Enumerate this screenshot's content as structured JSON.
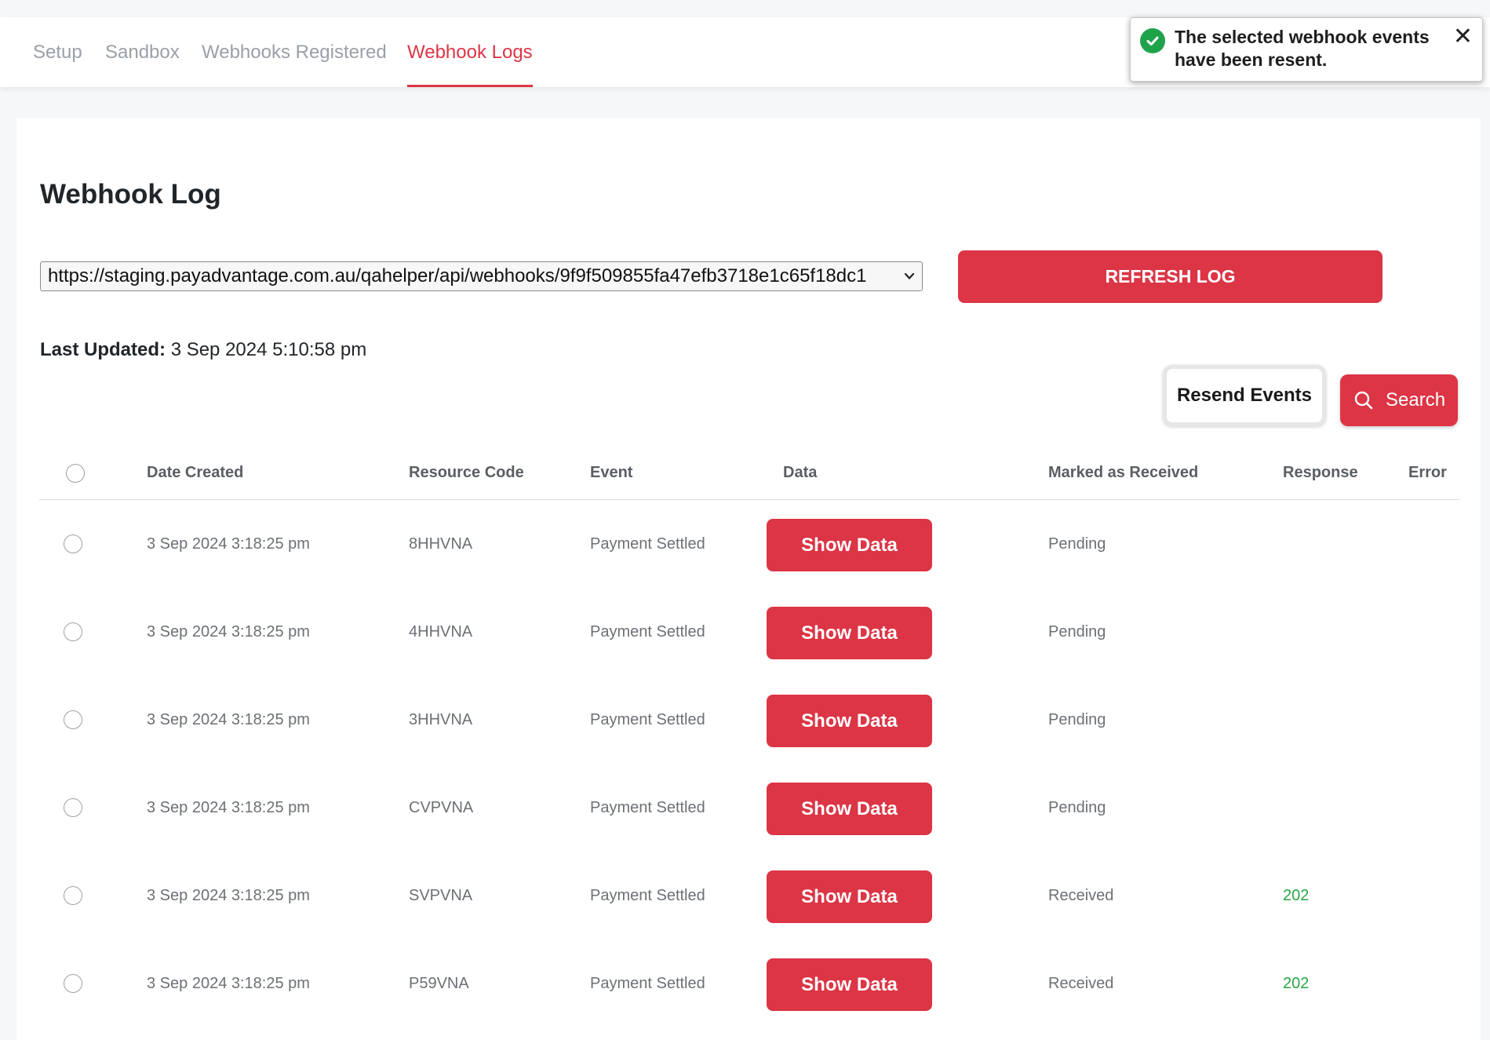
{
  "nav": {
    "tabs": [
      {
        "label": "Setup",
        "active": false
      },
      {
        "label": "Sandbox",
        "active": false
      },
      {
        "label": "Webhooks Registered",
        "active": false
      },
      {
        "label": "Webhook Logs",
        "active": true
      }
    ]
  },
  "toast": {
    "message": "The selected webhook events have been resent.",
    "icon": "check-circle-icon",
    "close_icon": "close-icon"
  },
  "main": {
    "title": "Webhook Log",
    "url_select_value": "https://staging.payadvantage.com.au/qahelper/api/webhooks/9f9f509855fa47efb3718e1c65f18dc1",
    "refresh_button": "REFRESH LOG",
    "last_updated_label": "Last Updated:",
    "last_updated_value": "3 Sep 2024 5:10:58 pm",
    "resend_button": "Resend Events",
    "search_button": "Search",
    "search_icon": "search-icon"
  },
  "table": {
    "headers": {
      "date_created": "Date Created",
      "resource_code": "Resource Code",
      "event": "Event",
      "data": "Data",
      "marked_as_received": "Marked as Received",
      "response": "Response",
      "error": "Error"
    },
    "show_data_label": "Show Data",
    "rows": [
      {
        "date": "3 Sep 2024 3:18:25 pm",
        "code": "8HHVNA",
        "event": "Payment Settled",
        "marked": "Pending",
        "response": "",
        "error": ""
      },
      {
        "date": "3 Sep 2024 3:18:25 pm",
        "code": "4HHVNA",
        "event": "Payment Settled",
        "marked": "Pending",
        "response": "",
        "error": ""
      },
      {
        "date": "3 Sep 2024 3:18:25 pm",
        "code": "3HHVNA",
        "event": "Payment Settled",
        "marked": "Pending",
        "response": "",
        "error": ""
      },
      {
        "date": "3 Sep 2024 3:18:25 pm",
        "code": "CVPVNA",
        "event": "Payment Settled",
        "marked": "Pending",
        "response": "",
        "error": ""
      },
      {
        "date": "3 Sep 2024 3:18:25 pm",
        "code": "SVPVNA",
        "event": "Payment Settled",
        "marked": "Received",
        "response": "202",
        "error": ""
      },
      {
        "date": "3 Sep 2024 3:18:25 pm",
        "code": "P59VNA",
        "event": "Payment Settled",
        "marked": "Received",
        "response": "202",
        "error": ""
      }
    ]
  },
  "colors": {
    "accent": "#dc3545",
    "success": "#28a745",
    "toast_icon": "#1fa34a"
  }
}
